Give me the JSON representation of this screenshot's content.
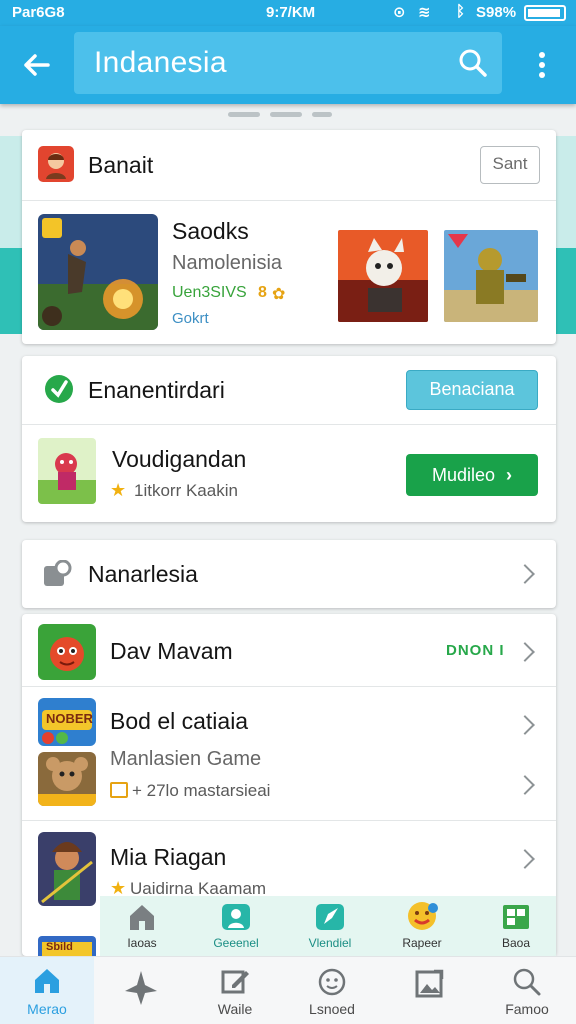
{
  "status_bar": {
    "carrier": "Par6G8",
    "time": "9:7/KM",
    "battery": "S98%"
  },
  "app_bar": {
    "search_query": "Indanesia"
  },
  "colors": {
    "primary": "#27ade3",
    "accent_green": "#19a24a",
    "teal": "#2fc0b6"
  },
  "card1": {
    "title": "Banait",
    "action": "Sant",
    "feature": {
      "name": "Saodks",
      "subtitle": "Namolenisia",
      "meta": "Uen3SIVS",
      "rating": "8",
      "label": "Gokrt"
    }
  },
  "card2": {
    "title": "Enanentirdari",
    "action": "Benaciana",
    "item": {
      "name": "Voudigandan",
      "rating_text": "1itkorr Kaakin",
      "button": "Mudileo"
    }
  },
  "card3": {
    "title": "Nanarlesia"
  },
  "list": [
    {
      "name": "Dav Mavam",
      "badge": "DNON I"
    },
    {
      "name": "Bod el catiaia",
      "icon_text": "NOBER"
    },
    {
      "name": "Manlasien Game",
      "meta": "+ 27lo mastarsieai"
    },
    {
      "name": "Mia Riagan",
      "meta": "Uaidirna Kaamam"
    },
    {
      "icon_text": "Sbild"
    }
  ],
  "sub_nav": [
    {
      "label": "Iaoas",
      "icon": "house-icon"
    },
    {
      "label": "Geeenel",
      "icon": "person-icon"
    },
    {
      "label": "Vlendiel",
      "icon": "rocket-icon"
    },
    {
      "label": "Rapeer",
      "icon": "emoji-icon"
    },
    {
      "label": "Baoa",
      "icon": "grid-icon"
    }
  ],
  "bottom_nav": [
    {
      "label": "Merao",
      "icon": "home-icon",
      "active": true
    },
    {
      "label": "",
      "icon": "airplane-icon"
    },
    {
      "label": "Waile",
      "icon": "edit-icon"
    },
    {
      "label": "Lsnoed",
      "icon": "smiley-icon"
    },
    {
      "label": "",
      "icon": "image-icon"
    },
    {
      "label": "Famoo",
      "icon": "search-icon"
    }
  ]
}
